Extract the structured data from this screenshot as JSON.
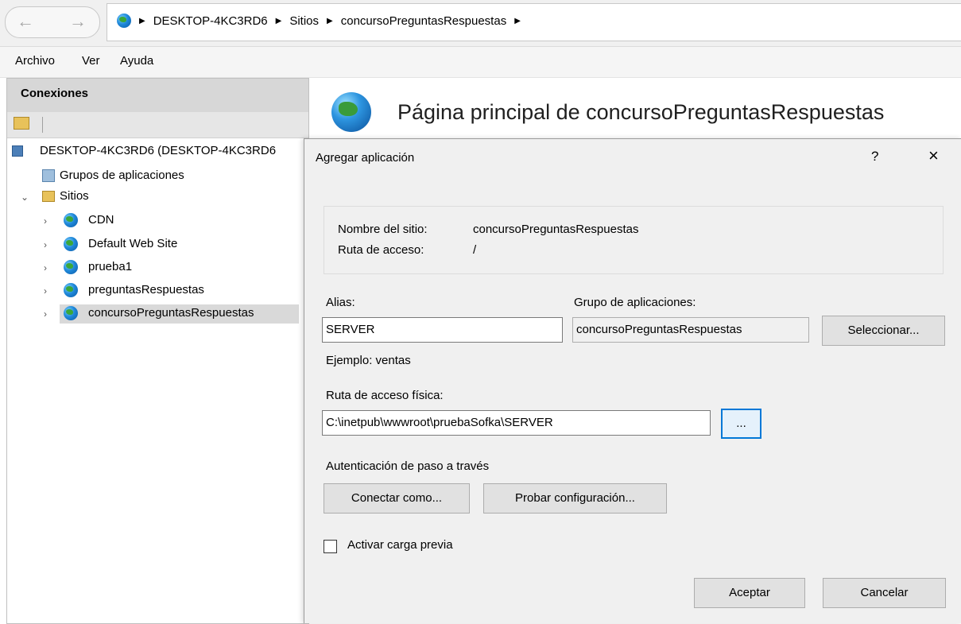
{
  "address_bar": {
    "crumbs": [
      "DESKTOP-4KC3RD6",
      "Sitios",
      "concursoPreguntasRespuestas"
    ]
  },
  "menu": {
    "items": [
      "Archivo",
      "Ver",
      "Ayuda"
    ]
  },
  "connections": {
    "title": "Conexiones",
    "tree": {
      "root": "DESKTOP-4KC3RD6 (DESKTOP-4KC3RD6",
      "app_pools": "Grupos de aplicaciones",
      "sites": "Sitios",
      "site_items": [
        "CDN",
        "Default Web Site",
        "prueba1",
        "preguntasRespuestas",
        "concursoPreguntasRespuestas"
      ],
      "selected_site": "concursoPreguntasRespuestas"
    }
  },
  "main": {
    "title": "Página principal de concursoPreguntasRespuestas"
  },
  "dialog": {
    "title": "Agregar aplicación",
    "help": "?",
    "close": "×",
    "site_name_label": "Nombre del sitio:",
    "site_name_value": "concursoPreguntasRespuestas",
    "path_label": "Ruta de acceso:",
    "path_value": "/",
    "alias_label": "Alias:",
    "alias_value": "SERVER",
    "app_pool_label": "Grupo de aplicaciones:",
    "app_pool_value": "concursoPreguntasRespuestas",
    "select_button": "Seleccionar...",
    "example_text": "Ejemplo: ventas",
    "physical_path_label": "Ruta de acceso física:",
    "physical_path_value": "C:\\inetpub\\wwwroot\\pruebaSofka\\SERVER",
    "browse_button": "...",
    "passthrough_label": "Autenticación de paso a través",
    "connect_as_button": "Conectar como...",
    "test_settings_button": "Probar configuración...",
    "preload_label": "Activar carga previa",
    "preload_checked": false,
    "ok_button": "Aceptar",
    "cancel_button": "Cancelar"
  }
}
